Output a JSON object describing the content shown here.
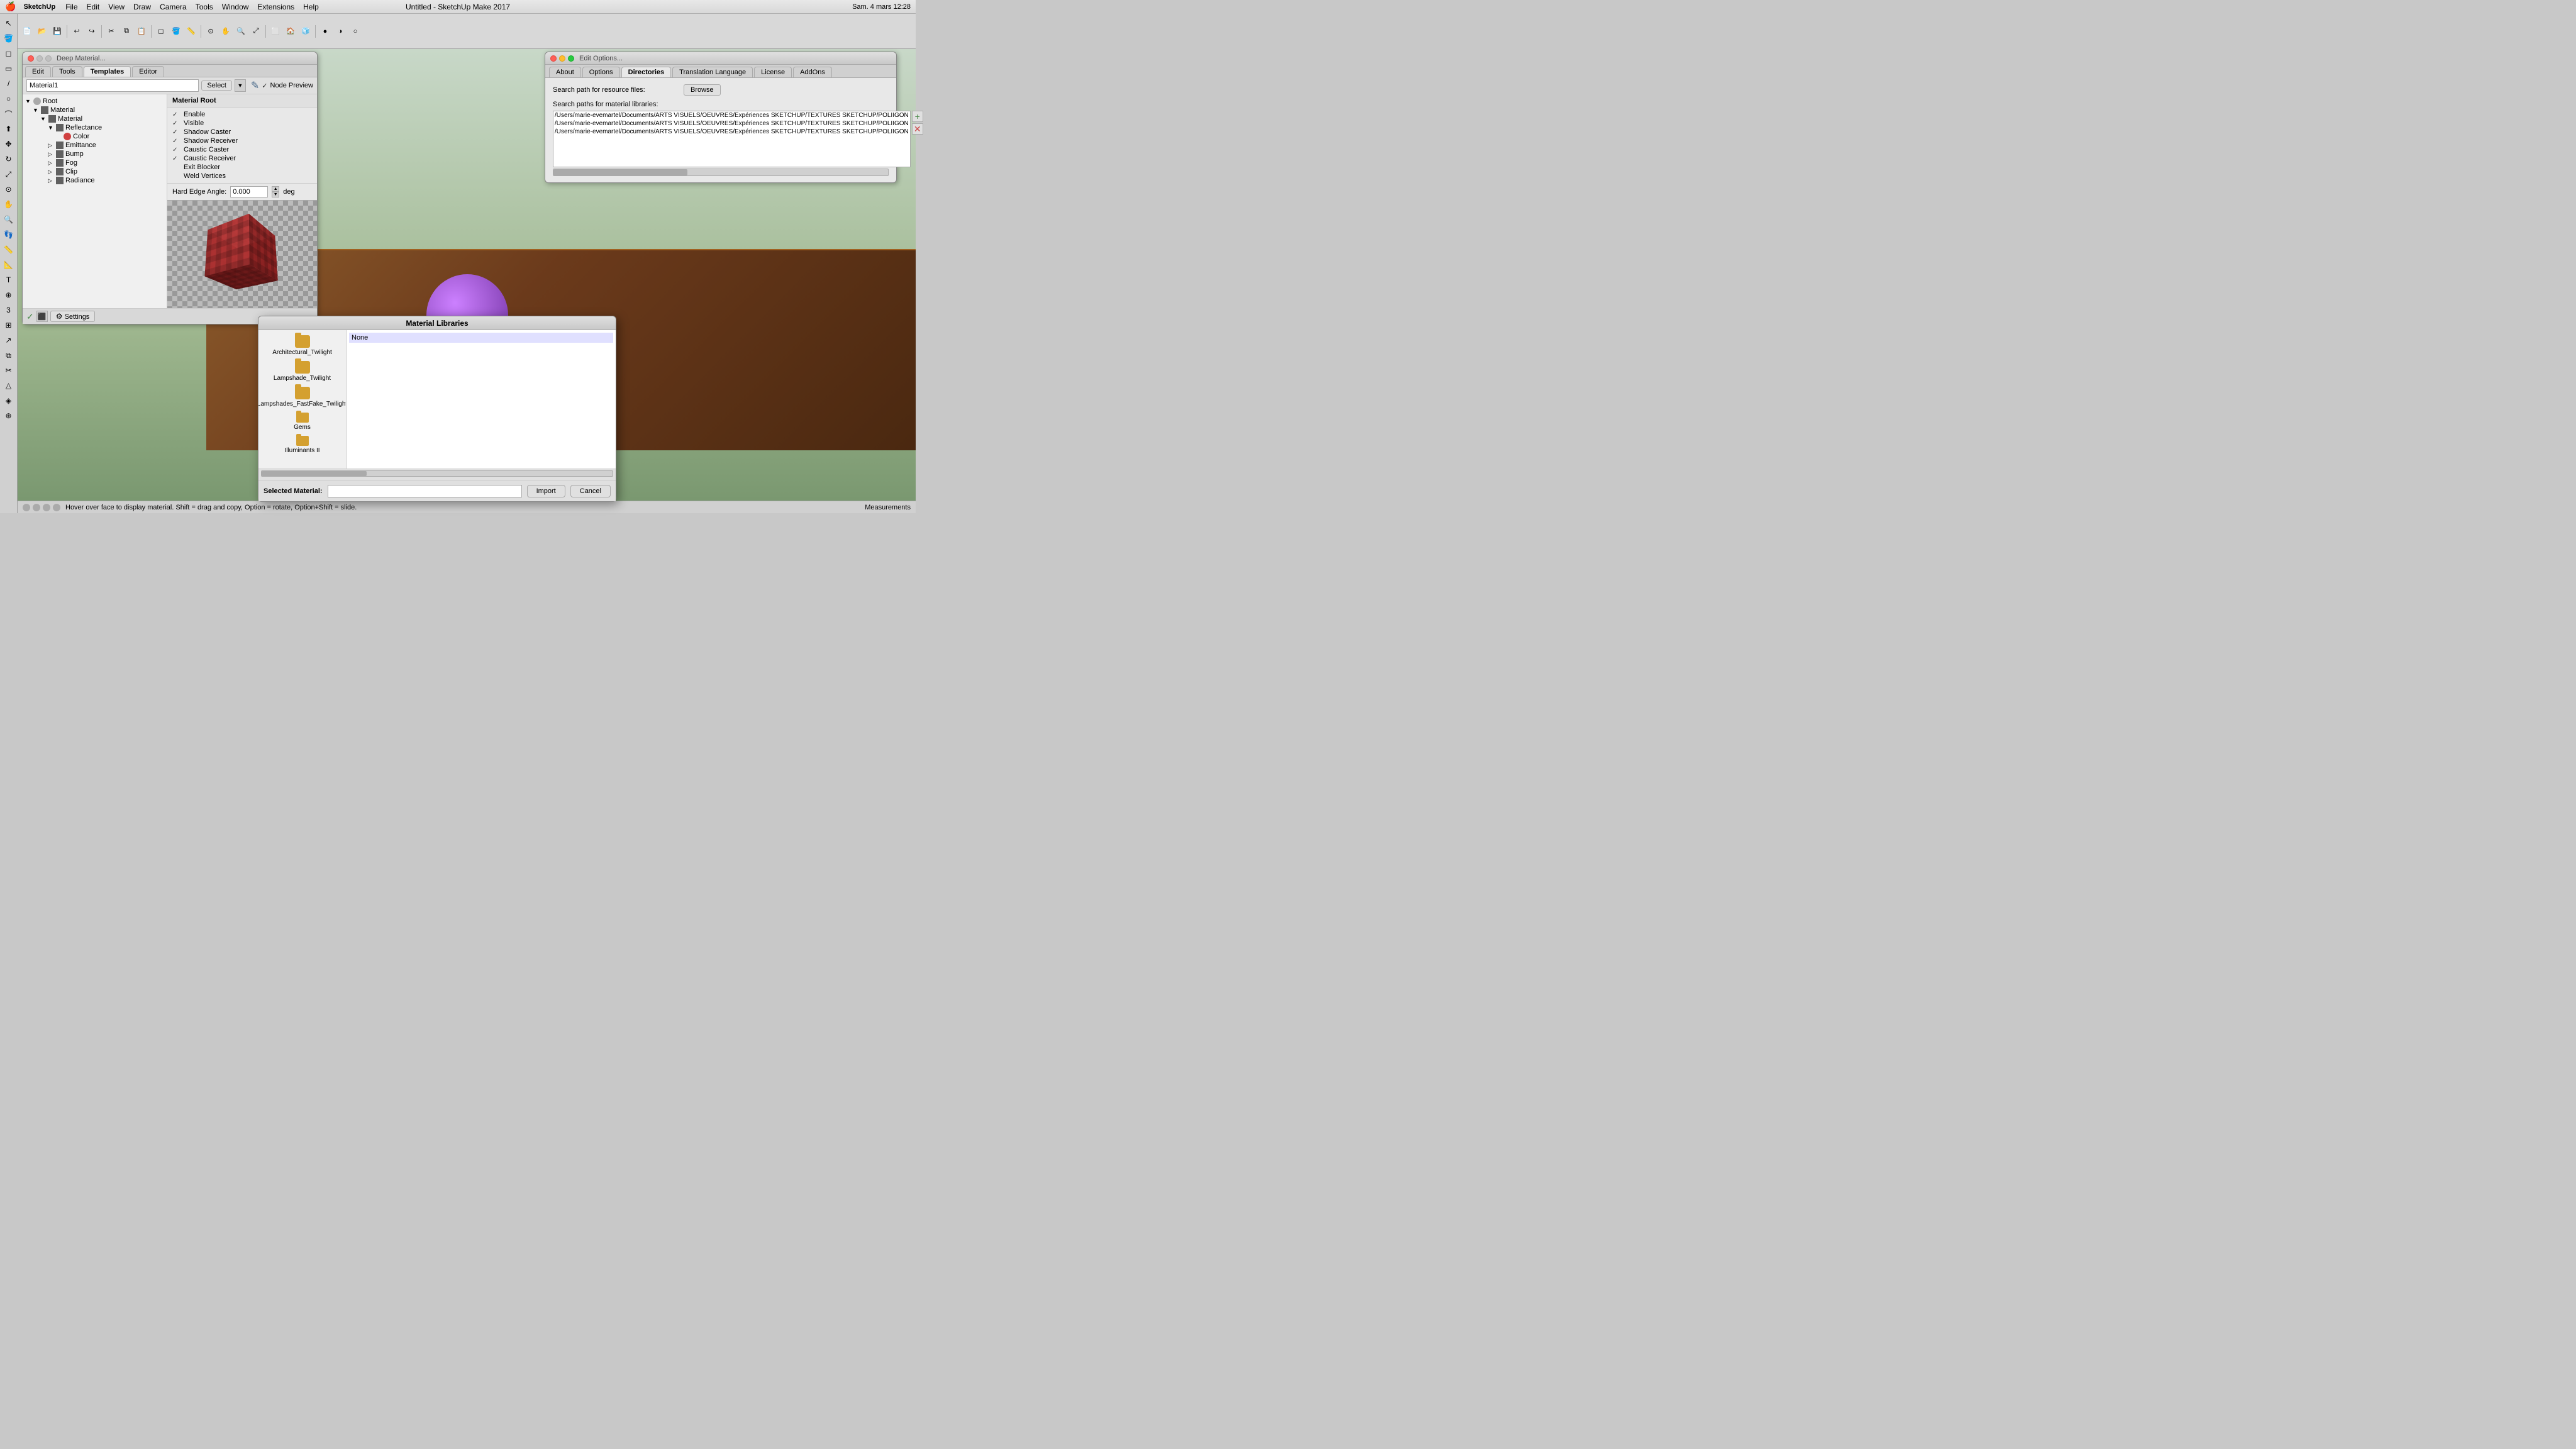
{
  "app": {
    "name": "SketchUp",
    "window_title": "Untitled - SketchUp Make 2017"
  },
  "menubar": {
    "apple": "🍎",
    "app_name": "SketchUp",
    "items": [
      "File",
      "Edit",
      "View",
      "Draw",
      "Camera",
      "Tools",
      "Window",
      "Extensions",
      "Help"
    ],
    "time": "Sam. 4 mars 12:28",
    "title": "Untitled - SketchUp Make 2017"
  },
  "deep_material_panel": {
    "title": "Deep Material...",
    "tabs": [
      "Edit",
      "Tools",
      "Templates",
      "Editor"
    ],
    "active_tab": "Templates",
    "material_name": "Material1",
    "select_label": "Select",
    "node_preview_label": "Node Preview",
    "material_root_header": "Material Root",
    "tree_items": [
      {
        "label": "Root",
        "level": 0,
        "type": "root",
        "icon": "●"
      },
      {
        "label": "Material",
        "level": 1,
        "type": "folder",
        "icon": "■"
      },
      {
        "label": "Material",
        "level": 2,
        "type": "folder",
        "icon": "■"
      },
      {
        "label": "Reflectance",
        "level": 3,
        "type": "item",
        "icon": "■"
      },
      {
        "label": "Color",
        "level": 4,
        "type": "color",
        "icon": "●"
      },
      {
        "label": "Emittance",
        "level": 3,
        "type": "item",
        "icon": "■"
      },
      {
        "label": "Bump",
        "level": 3,
        "type": "item",
        "icon": "■"
      },
      {
        "label": "Fog",
        "level": 3,
        "type": "item",
        "icon": "■"
      },
      {
        "label": "Clip",
        "level": 3,
        "type": "item",
        "icon": "■"
      },
      {
        "label": "Radiance",
        "level": 3,
        "type": "item",
        "icon": "■"
      }
    ],
    "options": [
      {
        "label": "Enable",
        "checked": true
      },
      {
        "label": "Visible",
        "checked": true
      },
      {
        "label": "Shadow Caster",
        "checked": true
      },
      {
        "label": "Shadow Receiver",
        "checked": true
      },
      {
        "label": "Caustic Caster",
        "checked": true
      },
      {
        "label": "Caustic Receiver",
        "checked": true
      },
      {
        "label": "Exit Blocker",
        "checked": false
      },
      {
        "label": "Weld Vertices",
        "checked": false
      }
    ],
    "hard_edge_label": "Hard Edge Angle:",
    "hard_edge_value": "0.000",
    "hard_edge_unit": "deg",
    "settings_label": "Settings"
  },
  "edit_options_panel": {
    "title": "Edit Options...",
    "tabs": [
      "About",
      "Options",
      "Directories",
      "Translation Language",
      "License",
      "AddOns"
    ],
    "active_tab": "Directories",
    "search_resource_label": "Search path for resource files:",
    "browse_label": "Browse",
    "search_material_label": "Search paths for material libraries:",
    "paths": [
      "/Users/marie-evemartel/Documents/ARTS VISUELS/OEUVRES/Expériences SKETCHUP/TEXTURES SKETCHUP/POLIIGON",
      "/Users/marie-evemartel/Documents/ARTS VISUELS/OEUVRES/Expériences SKETCHUP/TEXTURES SKETCHUP/POLIIGON",
      "/Users/marie-evemartel/Documents/ARTS VISUELS/OEUVRES/Expériences SKETCHUP/TEXTURES SKETCHUP/POLIIGON"
    ]
  },
  "material_libraries_dialog": {
    "title": "Material Libraries",
    "libraries": [
      {
        "name": "Architectural_Twilight",
        "type": "folder"
      },
      {
        "name": "Lampshade_Twilight",
        "type": "folder"
      },
      {
        "name": "Lampshades_FastFake_Twilight",
        "type": "folder"
      },
      {
        "name": "Gems",
        "type": "folder-sm"
      },
      {
        "name": "Illuminants II",
        "type": "folder-sm"
      }
    ],
    "right_content": [
      "None"
    ],
    "selected_material_label": "Selected Material:",
    "selected_material_value": "",
    "import_label": "Import",
    "cancel_label": "Cancel"
  },
  "statusbar": {
    "message": "Hover over face to display material. Shift = drag and copy, Option = rotate, Option+Shift = slide.",
    "measurements_label": "Measurements"
  }
}
